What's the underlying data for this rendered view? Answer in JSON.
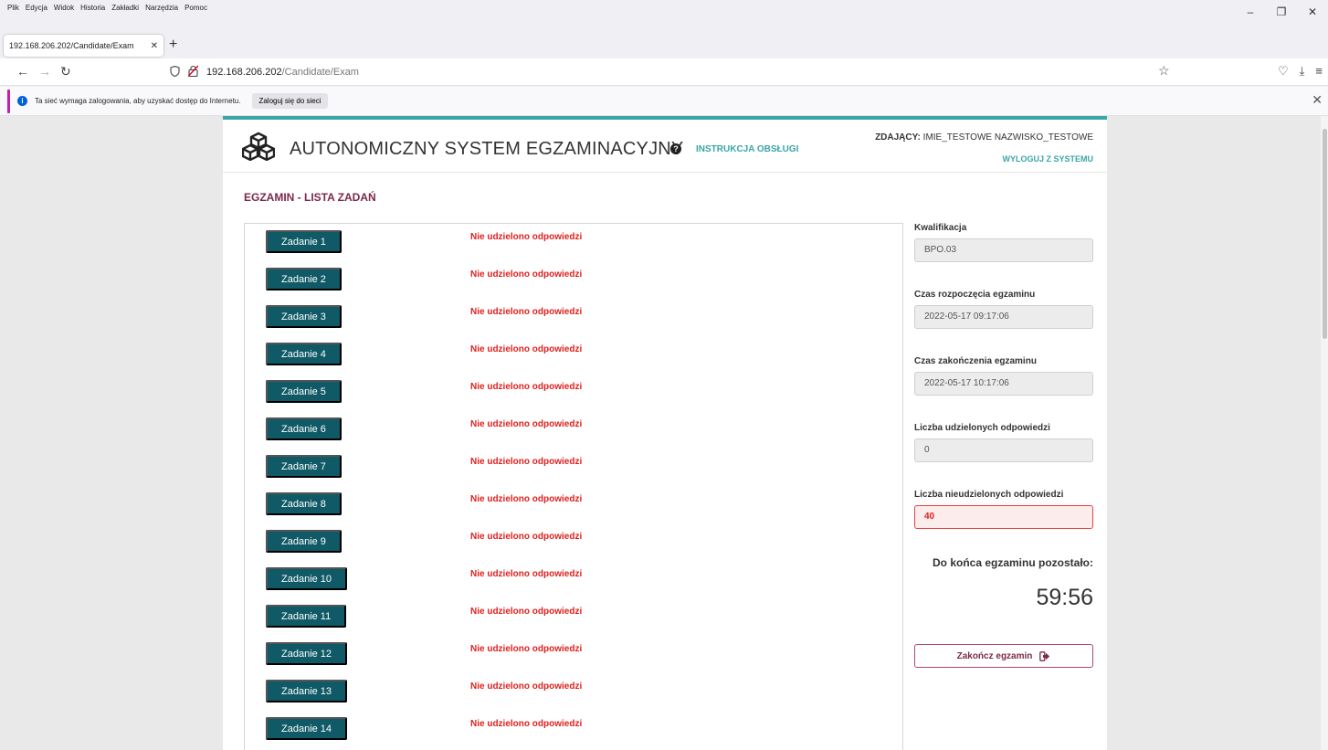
{
  "browser": {
    "menu": [
      "Plik",
      "Edycja",
      "Widok",
      "Historia",
      "Zakładki",
      "Narzędzia",
      "Pomoc"
    ],
    "tab_title": "192.168.206.202/Candidate/Exam",
    "url_host": "192.168.206.202",
    "url_path": "/Candidate/Exam",
    "notification_text": "Ta sieć wymaga zalogowania, aby uzyskać dostęp do Internetu.",
    "notification_button": "Zaloguj się do sieci"
  },
  "header": {
    "title": "AUTONOMICZNY SYSTEM EGZAMINACYJNY",
    "help_link": "INSTRUKCJA OBSŁUGI",
    "candidate_label": "ZDAJĄCY:",
    "candidate_name": "IMIE_TESTOWE NAZWISKO_TESTOWE",
    "logout": "WYLOGUJ Z SYSTEMU"
  },
  "page_title": "EGZAMIN - LISTA ZADAŃ",
  "tasks": [
    {
      "label": "Zadanie 1",
      "status": "Nie udzielono odpowiedzi"
    },
    {
      "label": "Zadanie 2",
      "status": "Nie udzielono odpowiedzi"
    },
    {
      "label": "Zadanie 3",
      "status": "Nie udzielono odpowiedzi"
    },
    {
      "label": "Zadanie 4",
      "status": "Nie udzielono odpowiedzi"
    },
    {
      "label": "Zadanie 5",
      "status": "Nie udzielono odpowiedzi"
    },
    {
      "label": "Zadanie 6",
      "status": "Nie udzielono odpowiedzi"
    },
    {
      "label": "Zadanie 7",
      "status": "Nie udzielono odpowiedzi"
    },
    {
      "label": "Zadanie 8",
      "status": "Nie udzielono odpowiedzi"
    },
    {
      "label": "Zadanie 9",
      "status": "Nie udzielono odpowiedzi"
    },
    {
      "label": "Zadanie 10",
      "status": "Nie udzielono odpowiedzi"
    },
    {
      "label": "Zadanie 11",
      "status": "Nie udzielono odpowiedzi"
    },
    {
      "label": "Zadanie 12",
      "status": "Nie udzielono odpowiedzi"
    },
    {
      "label": "Zadanie 13",
      "status": "Nie udzielono odpowiedzi"
    },
    {
      "label": "Zadanie 14",
      "status": "Nie udzielono odpowiedzi"
    }
  ],
  "sidebar": {
    "qualification_label": "Kwalifikacja",
    "qualification": "BPO.03",
    "start_label": "Czas rozpoczęcia egzaminu",
    "start_time": "2022-05-17 09:17:06",
    "end_label": "Czas zakończenia egzaminu",
    "end_time": "2022-05-17 10:17:06",
    "answered_label": "Liczba udzielonych odpowiedzi",
    "answered": "0",
    "unanswered_label": "Liczba nieudzielonych odpowiedzi",
    "unanswered": "40",
    "remaining_label": "Do końca egzaminu pozostało:",
    "remaining_time": "59:56",
    "finish_button": "Zakończ egzamin"
  },
  "colors": {
    "accent": "#3aa6a6",
    "task_button": "#0f5a66",
    "status_red": "#e0201e",
    "title_maroon": "#7b2a4a"
  }
}
